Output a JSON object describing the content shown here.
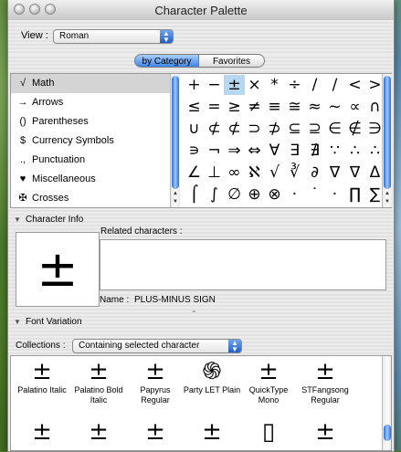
{
  "window": {
    "title": "Character Palette"
  },
  "view": {
    "label": "View :",
    "value": "Roman"
  },
  "tabs": [
    {
      "label": "by Category",
      "selected": true
    },
    {
      "label": "Favorites",
      "selected": false
    }
  ],
  "categories": [
    {
      "icon": "√",
      "label": "Math"
    },
    {
      "icon": "→",
      "label": "Arrows"
    },
    {
      "icon": "()",
      "label": "Parentheses"
    },
    {
      "icon": "$",
      "label": "Currency Symbols"
    },
    {
      "icon": ".,",
      "label": "Punctuation"
    },
    {
      "icon": "♥",
      "label": "Miscellaneous"
    },
    {
      "icon": "✠",
      "label": "Crosses"
    }
  ],
  "characters": [
    [
      "+",
      "−",
      "±",
      "×",
      "*",
      "÷",
      "/",
      "∕",
      "<",
      ">"
    ],
    [
      "≤",
      "=",
      "≥",
      "≠",
      "≡",
      "≅",
      "≈",
      "~",
      "∝",
      "∩"
    ],
    [
      "∪",
      "⊄",
      "⊄",
      "⊃",
      "⊅",
      "⊆",
      "⊇",
      "∈",
      "∉",
      "∋"
    ],
    [
      "∍",
      "¬",
      "⇒",
      "⇔",
      "∀",
      "∃",
      "∄",
      "∵",
      "∴",
      "∴"
    ],
    [
      "∠",
      "⊥",
      "∞",
      "ℵ",
      "√",
      "∛",
      "∂",
      "∇",
      "∇",
      "Δ"
    ],
    [
      "⌠",
      "∫",
      "∅",
      "⊕",
      "⊗",
      "·",
      "˙",
      "·",
      "∏",
      "∑"
    ]
  ],
  "character_info": {
    "label": "Character Info",
    "preview": "±",
    "related_label": "Related characters :",
    "name_label": "Name :",
    "name_value": "PLUS-MINUS SIGN"
  },
  "font_variation": {
    "label": "Font Variation",
    "collections_label": "Collections :",
    "collections_value": "Containing selected character",
    "fonts": [
      {
        "glyph": "±",
        "name": "Palatino Italic"
      },
      {
        "glyph": "±",
        "name": "Palatino Bold Italic"
      },
      {
        "glyph": "±",
        "name": "Papyrus Regular"
      },
      {
        "glyph": "֍",
        "name": "Party LET Plain"
      },
      {
        "glyph": "±",
        "name": "QuickType Mono"
      },
      {
        "glyph": "±",
        "name": "STFangsong Regular"
      }
    ],
    "second_row": [
      "±",
      "±",
      "±",
      "±",
      "▯",
      "±"
    ]
  }
}
